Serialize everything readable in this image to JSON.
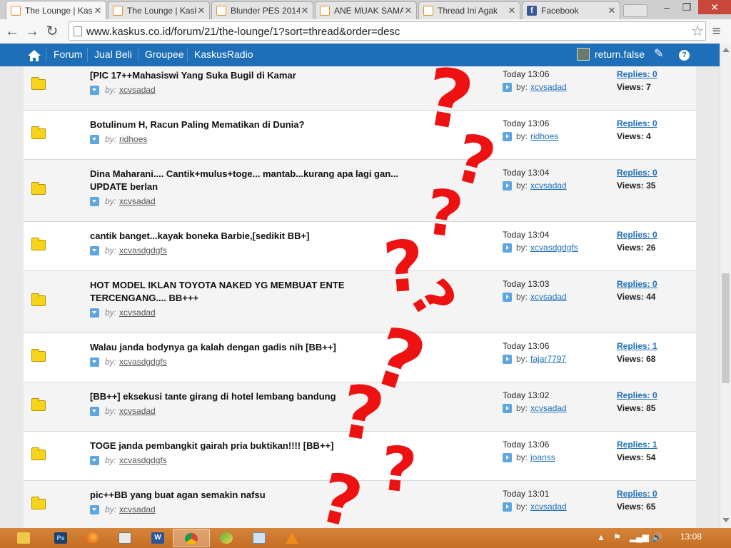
{
  "tabs": [
    {
      "title": "The Lounge | Kaskus",
      "icon": "kaskus-favicon",
      "active": true
    },
    {
      "title": "The Lounge | Kaskus",
      "icon": "kaskus-favicon",
      "active": false
    },
    {
      "title": "Blunder PES 2014",
      "icon": "kaskus-favicon",
      "active": false
    },
    {
      "title": "ANE MUAK SAMA",
      "icon": "kaskus-favicon",
      "active": false
    },
    {
      "title": "Thread Ini Agak",
      "icon": "kaskus-favicon",
      "active": false
    },
    {
      "title": "Facebook",
      "icon": "facebook-favicon",
      "active": false
    }
  ],
  "window": {
    "minimize": "–",
    "maximize": "❐",
    "close": "✕"
  },
  "toolbar": {
    "back": "←",
    "forward": "→",
    "reload": "↻",
    "url": "www.kaskus.co.id/forum/21/the-lounge/1?sort=thread&order=desc",
    "star": "☆",
    "menu": "≡"
  },
  "sitenav": {
    "home_icon": "home-icon",
    "items": [
      "Forum",
      "Jual Beli",
      "Groupee",
      "KaskusRadio"
    ],
    "username": "return.false"
  },
  "labels": {
    "by": "by:"
  },
  "threads": [
    {
      "title": "[PIC 17++Mahasiswi Yang Suka Bugil di Kamar",
      "author": "xcvsadad",
      "time": "Today 13:06",
      "last_author": "xcvsadad",
      "replies": "Replies: 0",
      "views": "Views: 7"
    },
    {
      "title": "Botulinum H, Racun Paling Mematikan di Dunia?",
      "author": "ridhoes",
      "time": "Today 13:06",
      "last_author": "ridhoes",
      "replies": "Replies: 0",
      "views": "Views: 4"
    },
    {
      "title": "Dina Maharani.... Cantik+mulus+toge... mantab...kurang apa lagi gan... UPDATE berlan",
      "author": "xcvsadad",
      "time": "Today 13:04",
      "last_author": "xcvsadad",
      "replies": "Replies: 0",
      "views": "Views: 35"
    },
    {
      "title": "cantik banget...kayak boneka Barbie,[sedikit BB+]",
      "author": "xcvasdgdgfs",
      "time": "Today 13:04",
      "last_author": "xcvasdgdgfs",
      "replies": "Replies: 0",
      "views": "Views: 26"
    },
    {
      "title": "HOT MODEL IKLAN TOYOTA NAKED YG MEMBUAT ENTE TERCENGANG.... BB+++",
      "author": "xcvsadad",
      "time": "Today 13:03",
      "last_author": "xcvsadad",
      "replies": "Replies: 0",
      "views": "Views: 44"
    },
    {
      "title": "Walau janda bodynya ga kalah dengan gadis nih [BB++]",
      "author": "xcvasdgdgfs",
      "time": "Today 13:06",
      "last_author": "fajar7797",
      "replies": "Replies: 1",
      "views": "Views: 68"
    },
    {
      "title": "[BB++] eksekusi tante girang di hotel lembang bandung",
      "author": "xcvsadad",
      "time": "Today 13:02",
      "last_author": "xcvsadad",
      "replies": "Replies: 0",
      "views": "Views: 85"
    },
    {
      "title": "TOGE janda pembangkit gairah pria buktikan!!!! [BB++]",
      "author": "xcvasdgdgfs",
      "time": "Today 13:06",
      "last_author": "joanss",
      "replies": "Replies: 1",
      "views": "Views: 54"
    },
    {
      "title": "pic++BB yang buat agan semakin nafsu",
      "author": "xcvsadad",
      "time": "Today 13:01",
      "last_author": "xcvsadad",
      "replies": "Replies: 0",
      "views": "Views: 65"
    }
  ],
  "annotations": {
    "mark": "?",
    "color": "#ee1111"
  },
  "taskbar": {
    "apps": [
      "file-explorer-icon",
      "photoshop-icon",
      "firefox-icon",
      "notepad-icon",
      "word-icon",
      "chrome-icon",
      "paint-icon",
      "photo-viewer-icon",
      "vlc-icon"
    ],
    "clock": "13:08"
  },
  "colors": {
    "site_blue": "#1e6fb8",
    "folder_yellow": "#f7d31a",
    "taskbar_orange": "#c46d24"
  }
}
